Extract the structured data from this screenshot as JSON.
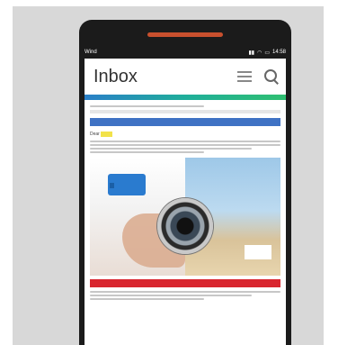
{
  "statusbar": {
    "carrier": "Wind",
    "time": "14:58"
  },
  "appbar": {
    "title": "Inbox"
  },
  "email": {
    "greeting": "Dear"
  },
  "colors": {
    "accent_start": "#2a7fc8",
    "accent_end": "#2fbf71",
    "banner_blue": "#3f72c4",
    "banner_red": "#d9262f"
  },
  "icons": {
    "menu": "hamburger-icon",
    "search": "search-icon"
  }
}
